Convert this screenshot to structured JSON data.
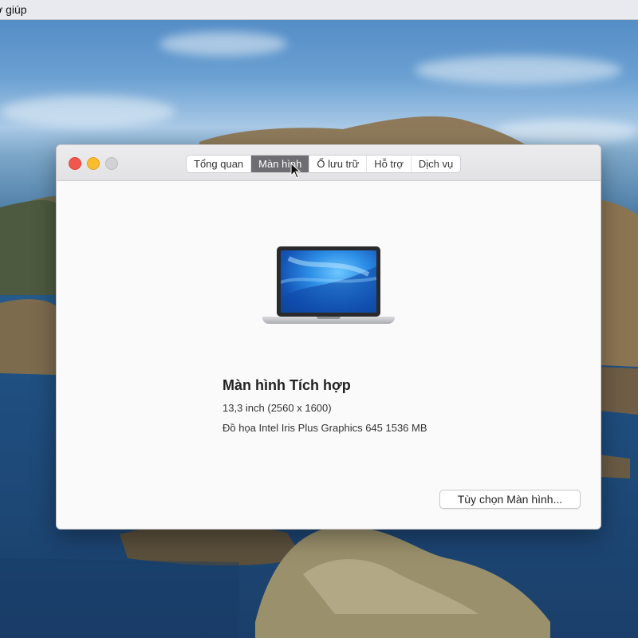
{
  "menubar": {
    "partial_item": "ợ giúp"
  },
  "window": {
    "tabs": [
      {
        "label": "Tổng quan",
        "active": false
      },
      {
        "label": "Màn hình",
        "active": true
      },
      {
        "label": "Ổ lưu trữ",
        "active": false
      },
      {
        "label": "Hỗ trợ",
        "active": false
      },
      {
        "label": "Dịch vụ",
        "active": false
      }
    ],
    "display": {
      "title": "Màn hình Tích hợp",
      "size_resolution": "13,3 inch (2560 x 1600)",
      "graphics": "Đồ họa Intel Iris Plus Graphics 645 1536 MB"
    },
    "options_button": "Tùy chọn Màn hình..."
  },
  "colors": {
    "close": "#f2574e",
    "minimize": "#f8bd2d",
    "zoom": "#d2d2d4",
    "active_tab": "#6e6e72"
  }
}
